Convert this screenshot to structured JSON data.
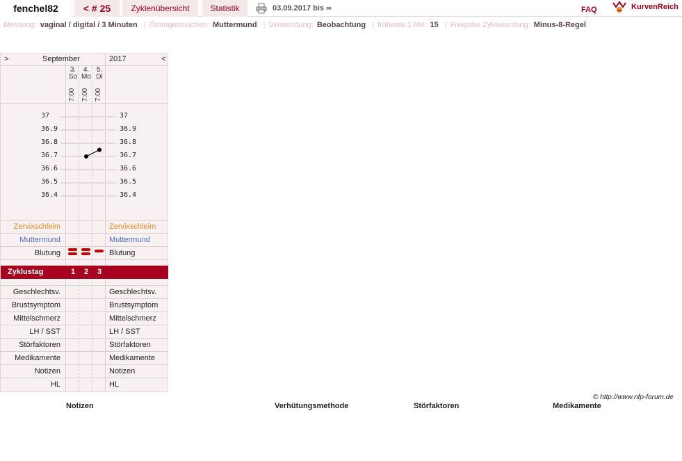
{
  "header": {
    "username": "fenchel82",
    "cycle_tab": "< # 25",
    "overview_tab": "Zyklenübersicht",
    "stats_tab": "Statistik",
    "date_range": "03.09.2017 bis ∞",
    "faq": "FAQ",
    "logo_text": "KurvenReich",
    "icons": {
      "print": "printer-icon",
      "logo": "kurvenreich-logo-icon"
    }
  },
  "info": [
    {
      "label": "Messung:",
      "value": "vaginal / digital / 3 Minuten"
    },
    {
      "label": "Östrogenzeichen:",
      "value": "Muttermund"
    },
    {
      "label": "Verwendung:",
      "value": "Beobachtung"
    },
    {
      "label": "früheste 1.hM:",
      "value": "15"
    },
    {
      "label": "Freigabe Zyklusanfang:",
      "value": "Minus-8-Regel"
    }
  ],
  "chart": {
    "nav_prev": ">",
    "nav_next": "<",
    "month": "September",
    "year": "2017",
    "days": [
      {
        "date": "3.",
        "weekday": "So",
        "time": "7:00",
        "cycle_day": "1",
        "bleeding_strokes": 2
      },
      {
        "date": "4.",
        "weekday": "Mo",
        "time": "7:00",
        "cycle_day": "2",
        "bleeding_strokes": 2
      },
      {
        "date": "5.",
        "weekday": "Di",
        "time": "7:00",
        "cycle_day": "3",
        "bleeding_strokes": 1
      }
    ],
    "temperature_scale": [
      "37",
      "36.9",
      "36.8",
      "36.7",
      "36.6",
      "36.5",
      "36.4"
    ],
    "temperatures": [
      null,
      36.7,
      36.75
    ],
    "rows": {
      "zervix": "Zervixschleim",
      "muttermund": "Muttermund",
      "blutung": "Blutung",
      "zyklustag": "Zyklustag",
      "geschlechtsv": "Geschlechtsv.",
      "brustsymptom": "Brustsymptom",
      "mittelschmerz": "Mittelschmerz",
      "lh": "LH / SST",
      "stoer": "Störfaktoren",
      "medikamente": "Medikamente",
      "notizen": "Notizen",
      "hl": "HL"
    },
    "colors": {
      "accent": "#a8001f",
      "zervix": "#e98a1a",
      "muttermund": "#4a6bc0",
      "bleeding": "#cc0000"
    }
  },
  "footer": {
    "copyright": "© http://www.nfp-forum.de",
    "headings": [
      "Notizen",
      "Verhütungsmethode",
      "Störfaktoren",
      "Medikamente"
    ]
  }
}
